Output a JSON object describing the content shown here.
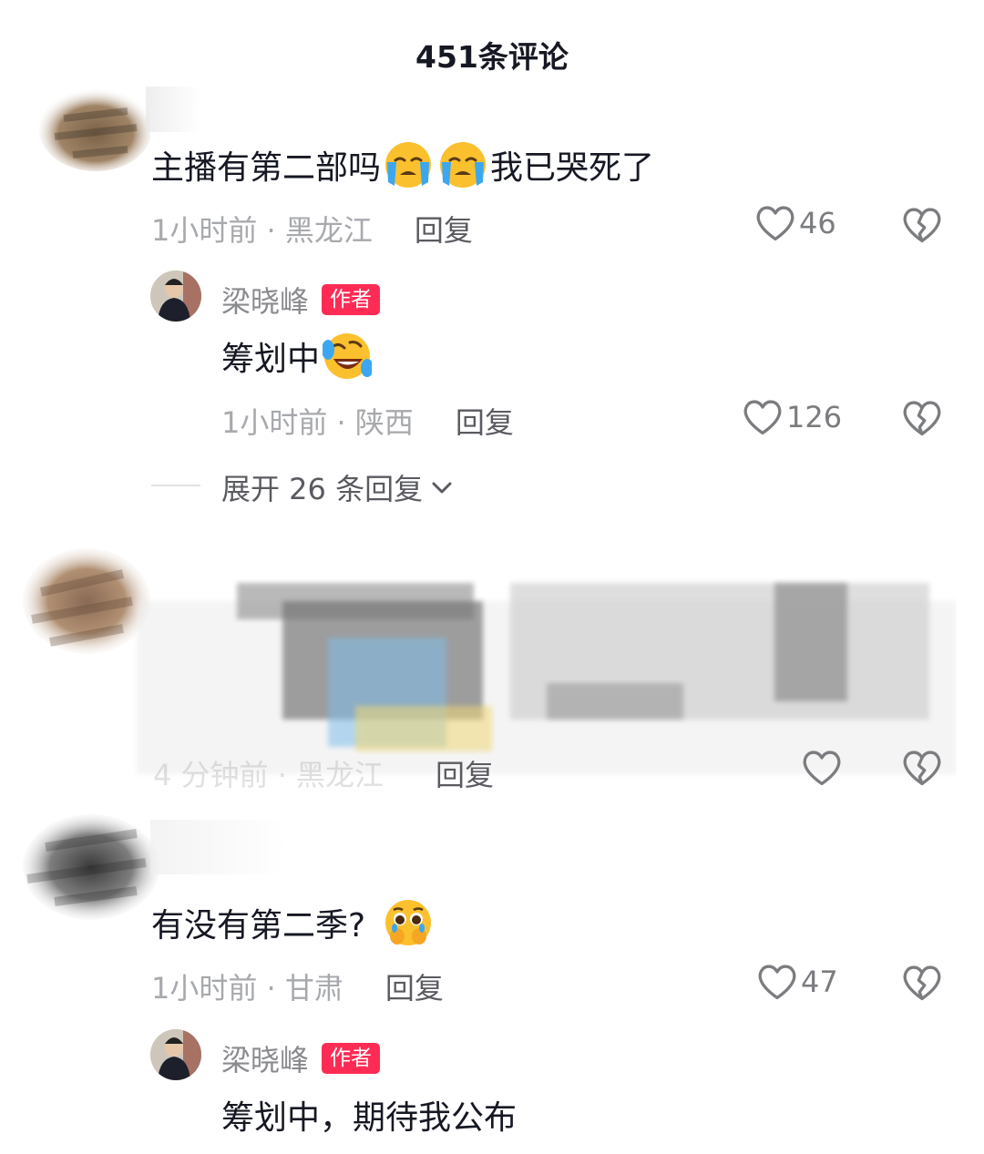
{
  "header": {
    "title": "451条评论"
  },
  "comments": [
    {
      "text_before": "主播有第二部吗",
      "emojis": [
        "loudly-crying-emoji",
        "loudly-crying-emoji"
      ],
      "text_after": "我已哭死了",
      "time_location": "1小时前 · 黑龙江",
      "reply_label": "回复",
      "likes": "46",
      "author_reply": {
        "username": "梁晓峰",
        "badge": "作者",
        "text": "筹划中",
        "emoji": "rofl-emoji",
        "time_location": "1小时前 · 陕西",
        "reply_label": "回复",
        "likes": "126"
      },
      "expand_label": "展开 26 条回复"
    },
    {
      "time_location": "4 分钟前 · 黑龙江",
      "reply_label": "回复",
      "likes": ""
    },
    {
      "text": "有没有第二季?",
      "emoji": "pleading-face-emoji",
      "time_location": "1小时前 · 甘肃",
      "reply_label": "回复",
      "likes": "47",
      "author_reply": {
        "username": "梁晓峰",
        "badge": "作者",
        "text": "筹划中，期待我公布"
      }
    }
  ],
  "colors": {
    "badge_bg": "#fe2c55",
    "text_primary": "#161823",
    "text_meta": "#a7a9ad",
    "emoji_face": "#fbc02d",
    "tears": "#3ba7f0"
  }
}
